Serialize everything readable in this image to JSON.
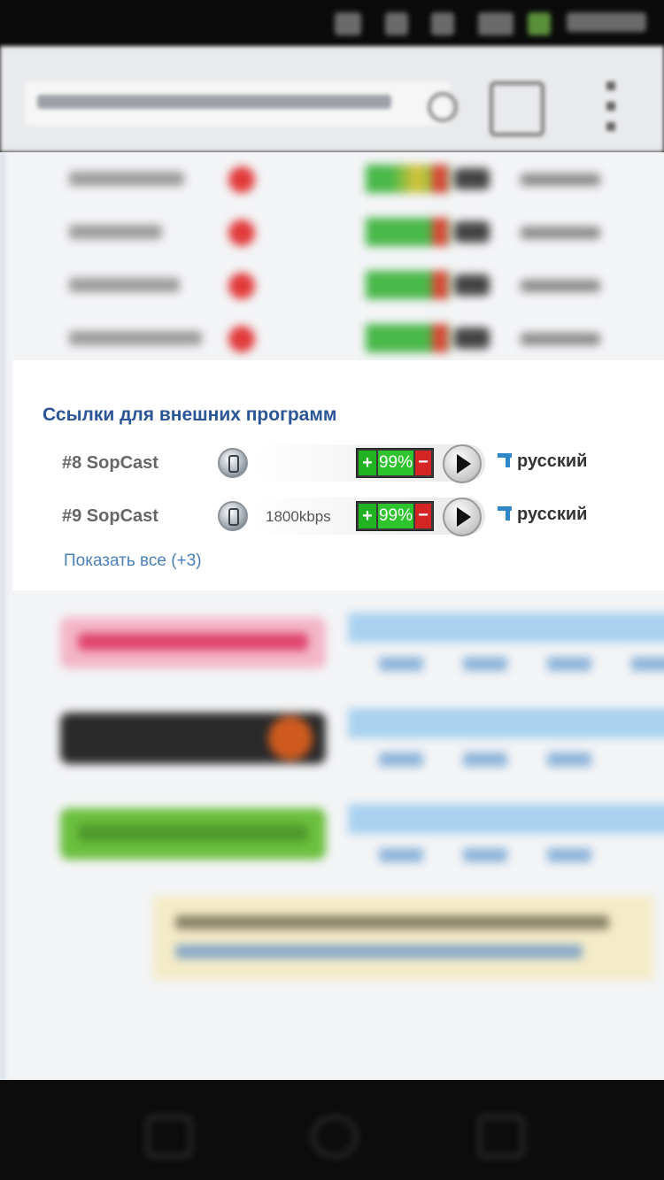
{
  "section": {
    "title": "Ссылки для внешних программ"
  },
  "links": [
    {
      "name": "#8 SopCast",
      "bitrate": "",
      "rating_plus": "+",
      "rating_pct": "99%",
      "rating_minus": "−",
      "language": "русский"
    },
    {
      "name": "#9 SopCast",
      "bitrate": "1800kbps",
      "rating_plus": "+",
      "rating_pct": "99%",
      "rating_minus": "−",
      "language": "русский"
    }
  ],
  "show_all_label": "Показать все (+3)",
  "colors": {
    "title_blue": "#2a5596",
    "link_blue": "#4a7fb8",
    "rating_green": "#2ec42e",
    "rating_red": "#d42424",
    "flag_blue": "#2e88c8"
  },
  "icons": {
    "app": "sopcast-icon",
    "play": "play-icon",
    "language": "language-flag-icon"
  }
}
